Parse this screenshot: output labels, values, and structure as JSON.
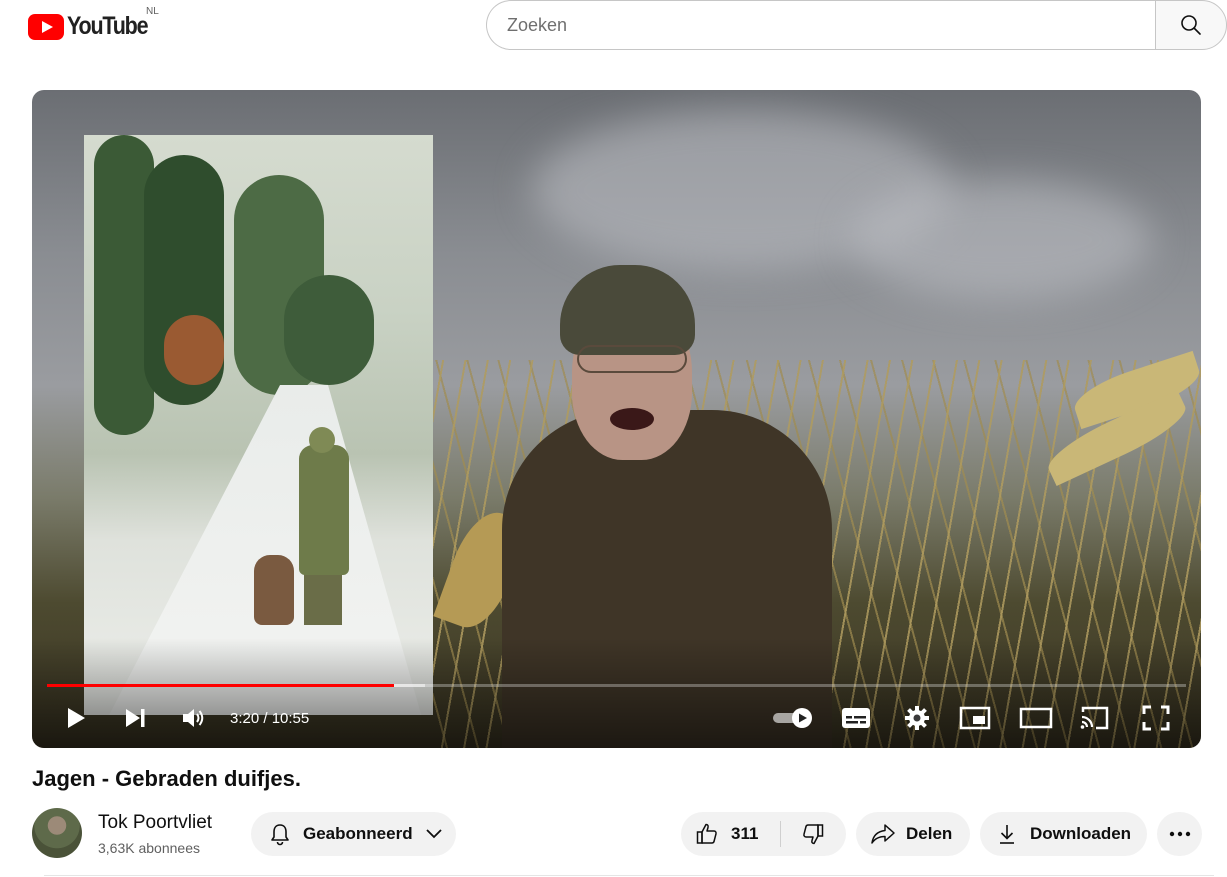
{
  "masthead": {
    "logo_text": "YouTube",
    "country_code": "NL",
    "search_placeholder": "Zoeken",
    "search_value": ""
  },
  "player": {
    "current_time": "3:20",
    "duration": "10:55",
    "time_display": "3:20 / 10:55",
    "progress_fraction": 0.305,
    "buffered_fraction": 0.332,
    "autoplay_on": true,
    "accent_color": "#ff0000"
  },
  "video": {
    "title": "Jagen - Gebraden duifjes."
  },
  "channel": {
    "name": "Tok Poortvliet",
    "subscribers": "3,63K abonnees",
    "subscribe_label": "Geabonneerd"
  },
  "actions": {
    "like_count": "311",
    "share_label": "Delen",
    "download_label": "Downloaden"
  },
  "icons": {
    "logo": "youtube-logo-icon",
    "search": "search-icon",
    "play": "play-icon",
    "next": "next-icon",
    "volume": "volume-icon",
    "autoplay": "autoplay-toggle-icon",
    "captions": "captions-icon",
    "settings": "gear-icon",
    "miniplayer": "miniplayer-icon",
    "theater": "theater-mode-icon",
    "cast": "cast-icon",
    "fullscreen": "fullscreen-icon",
    "bell": "bell-icon",
    "chevron": "chevron-down-icon",
    "like": "thumbs-up-icon",
    "dislike": "thumbs-down-icon",
    "share": "share-icon",
    "download": "download-icon",
    "more": "more-icon"
  }
}
